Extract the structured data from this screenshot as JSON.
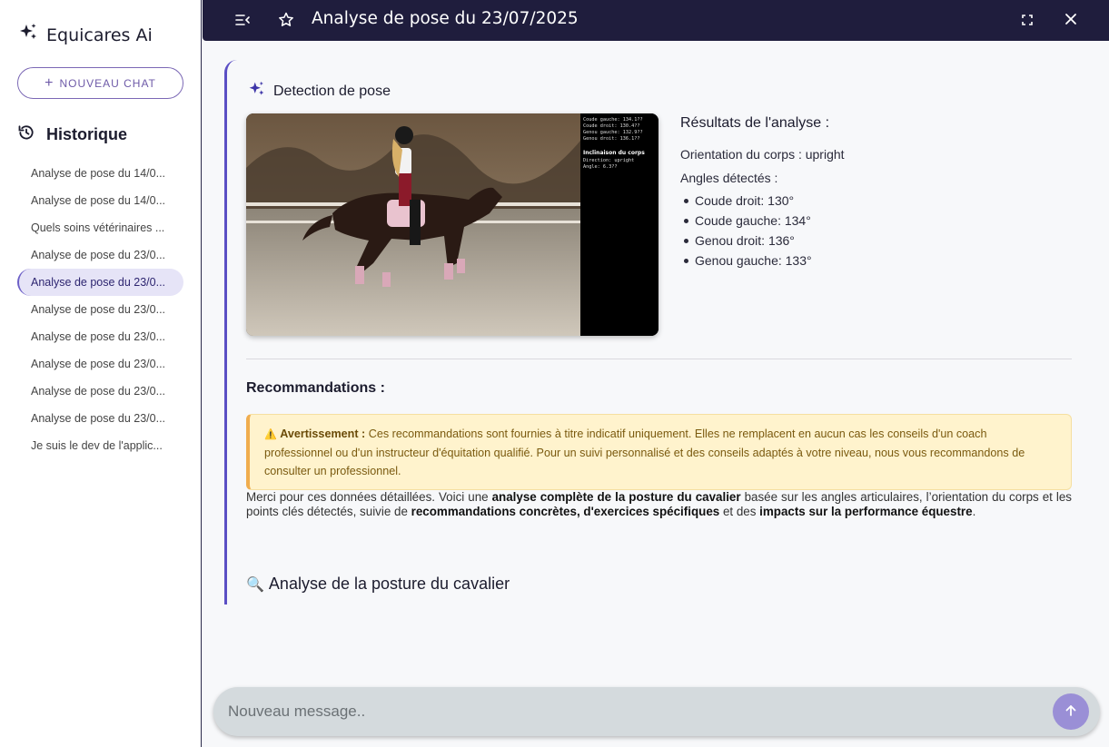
{
  "app": {
    "name": "Equicares Ai"
  },
  "sidebar": {
    "new_chat_label": "NOUVEAU CHAT",
    "history_title": "Historique",
    "items": [
      {
        "label": "Analyse de pose du 14/0..."
      },
      {
        "label": "Analyse de pose du 14/0..."
      },
      {
        "label": "Quels soins vétérinaires ..."
      },
      {
        "label": "Analyse de pose du 23/0..."
      },
      {
        "label": "Analyse de pose du 23/0..."
      },
      {
        "label": "Analyse de pose du 23/0..."
      },
      {
        "label": "Analyse de pose du 23/0..."
      },
      {
        "label": "Analyse de pose du 23/0..."
      },
      {
        "label": "Analyse de pose du 23/0..."
      },
      {
        "label": "Analyse de pose du 23/0..."
      },
      {
        "label": "Je suis le dev de l'applic..."
      }
    ],
    "active_index": 4
  },
  "topbar": {
    "title": "Analyse de pose du 23/07/2025"
  },
  "detection": {
    "title": "Detection de pose",
    "image_overlay": {
      "lines_top": [
        "Coude gauche: 134.1??",
        "Coude droit: 130.4??",
        "Genou gauche: 132.9??",
        "Genou droit: 136.1??"
      ],
      "incl_title": "Inclinaison du corps",
      "incl_lines": [
        "Direction: upright",
        "Angle: 6.3??"
      ]
    }
  },
  "results": {
    "title": "Résultats de l'analyse :",
    "orientation": "Orientation du corps : upright",
    "angles_title": "Angles détectés :",
    "angles": [
      "Coude droit: 130°",
      "Coude gauche: 134°",
      "Genou droit: 136°",
      "Genou gauche: 133°"
    ]
  },
  "recommendations": {
    "title": "Recommandations :",
    "warning_icon": "⚠️",
    "warning_label": "Avertissement :",
    "warning_text": " Ces recommandations sont fournies à titre indicatif uniquement. Elles ne remplacent en aucun cas les conseils d'un coach professionnel ou d'un instructeur d'équitation qualifié. Pour un suivi personnalisé et des conseils adaptés à votre niveau, nous vous recommandons de consulter un professionnel.",
    "para_1": "Merci pour ces données détaillées. Voici une ",
    "para_b1": "analyse complète de la posture du cavalier",
    "para_2": " basée sur les angles articulaires, l’orientation du corps et les points clés détectés, suivie de ",
    "para_b2": "recommandations concrètes, d'exercices spécifiques",
    "para_3": " et des ",
    "para_b3": "impacts sur la performance équestre",
    "para_4": "."
  },
  "posture": {
    "icon": "🔍",
    "title": "Analyse de la posture du cavalier"
  },
  "composer": {
    "placeholder": "Nouveau message.."
  },
  "colors": {
    "accent": "#5b4fc4",
    "topbar": "#1f1d3d",
    "send": "#9a8fd6",
    "warning_bg": "#fff3cd"
  }
}
